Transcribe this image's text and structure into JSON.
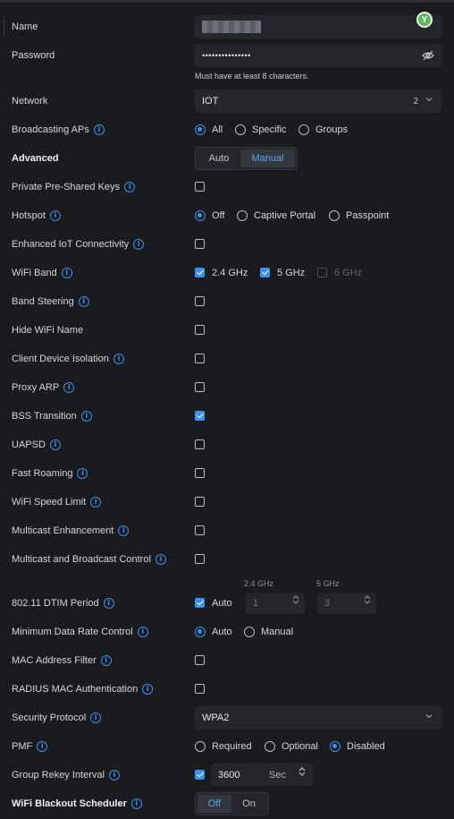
{
  "name": {
    "label": "Name",
    "value": ""
  },
  "password": {
    "label": "Password",
    "value": "•••••••••••••••",
    "hint": "Must have at least 8 characters."
  },
  "network": {
    "label": "Network",
    "value": "IOT",
    "count": "2"
  },
  "broadcasting": {
    "label": "Broadcasting APs",
    "options": [
      "All",
      "Specific",
      "Groups"
    ],
    "selected": "All"
  },
  "advanced": {
    "label": "Advanced",
    "options": [
      "Auto",
      "Manual"
    ],
    "selected": "Manual"
  },
  "ppsk": {
    "label": "Private Pre-Shared Keys",
    "checked": false
  },
  "hotspot": {
    "label": "Hotspot",
    "options": [
      "Off",
      "Captive Portal",
      "Passpoint"
    ],
    "selected": "Off"
  },
  "iot": {
    "label": "Enhanced IoT Connectivity",
    "checked": false
  },
  "wifiband": {
    "label": "WiFi Band",
    "options": [
      {
        "label": "2.4 GHz",
        "checked": true
      },
      {
        "label": "5 GHz",
        "checked": true
      },
      {
        "label": "6 GHz",
        "checked": false,
        "disabled": true
      }
    ]
  },
  "rows": {
    "band_steering": "Band Steering",
    "hide_name": "Hide WiFi Name",
    "isolation": "Client Device Isolation",
    "proxy_arp": "Proxy ARP",
    "bss": "BSS Transition",
    "uapsd": "UAPSD",
    "fast_roaming": "Fast Roaming",
    "speed_limit": "WiFi Speed Limit",
    "multicast_enh": "Multicast Enhancement",
    "multicast_ctrl": "Multicast and Broadcast Control",
    "mac_filter": "MAC Address Filter",
    "radius_mac": "RADIUS MAC Authentication"
  },
  "checks": {
    "bss": true
  },
  "dtim": {
    "label": "802.11 DTIM Period",
    "auto_label": "Auto",
    "auto": true,
    "col1": "2.4 GHz",
    "col2": "5 GHz",
    "v1": "1",
    "v2": "3"
  },
  "min_rate": {
    "label": "Minimum Data Rate Control",
    "options": [
      "Auto",
      "Manual"
    ],
    "selected": "Auto"
  },
  "security": {
    "label": "Security Protocol",
    "value": "WPA2"
  },
  "pmf": {
    "label": "PMF",
    "options": [
      "Required",
      "Optional",
      "Disabled"
    ],
    "selected": "Disabled"
  },
  "rekey": {
    "label": "Group Rekey Interval",
    "value": "3600",
    "unit": "Sec",
    "checked": true
  },
  "blackout": {
    "label": "WiFi Blackout Scheduler",
    "options": [
      "Off",
      "On"
    ],
    "selected": "Off"
  },
  "colors": {
    "accent": "#3b8ff0",
    "background": "#1a1b1e",
    "field": "#24262b",
    "avatar": "#5bb85d"
  }
}
